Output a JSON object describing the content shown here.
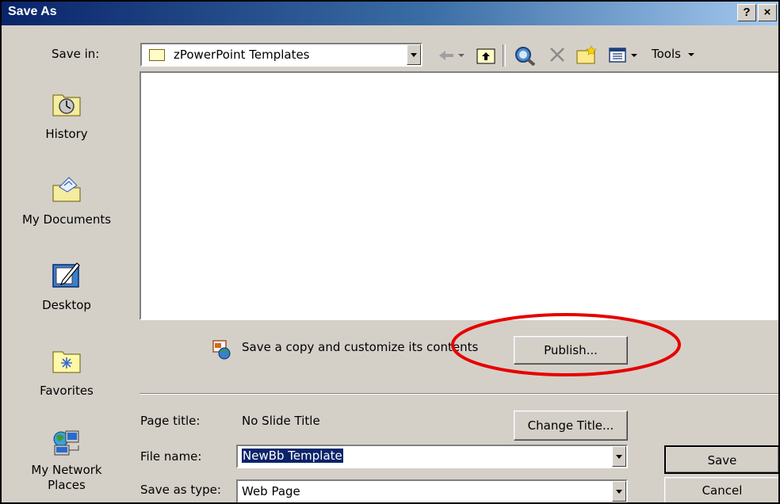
{
  "window": {
    "title": "Save As",
    "help_btn": "?",
    "close_btn": "×"
  },
  "toolbar": {
    "save_in_label": "Save in:",
    "save_in_value": "zPowerPoint Templates",
    "tools_label": "Tools"
  },
  "places": [
    {
      "label": "History"
    },
    {
      "label": "My Documents"
    },
    {
      "label": "Desktop"
    },
    {
      "label": "Favorites"
    },
    {
      "label": "My Network Places"
    }
  ],
  "publish": {
    "text": "Save a copy and customize its contents",
    "button_label": "Publish..."
  },
  "form": {
    "page_title_label": "Page title:",
    "page_title_value": "No Slide Title",
    "change_title_label": "Change Title...",
    "file_name_label": "File name:",
    "file_name_value": "NewBb Template",
    "save_type_label": "Save as type:",
    "save_type_value": "Web Page",
    "save_label": "Save",
    "cancel_label": "Cancel"
  },
  "annotation": {
    "color": "#e60000"
  }
}
